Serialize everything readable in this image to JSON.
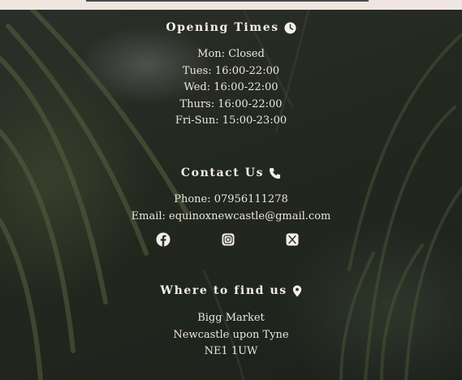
{
  "opening": {
    "title": "Opening Times",
    "icon": "clock-icon",
    "hours": [
      "Mon: Closed",
      "Tues: 16:00-22:00",
      "Wed: 16:00-22:00",
      "Thurs: 16:00-22:00",
      "Fri-Sun: 15:00-23:00"
    ]
  },
  "contact": {
    "title": "Contact Us",
    "icon": "phone-icon",
    "phone": "Phone: 07956111278",
    "email": "Email: equinoxnewcastle@gmail.com",
    "social": [
      "facebook-icon",
      "instagram-icon",
      "x-twitter-icon"
    ]
  },
  "location": {
    "title": "Where to find us",
    "icon": "location-pin-icon",
    "address": [
      "Bigg Market",
      "Newcastle upon Tyne",
      "NE1 1UW"
    ]
  },
  "colors": {
    "text": "#f1ece4",
    "background": "#23281f",
    "top_bar": "#efe6df"
  }
}
